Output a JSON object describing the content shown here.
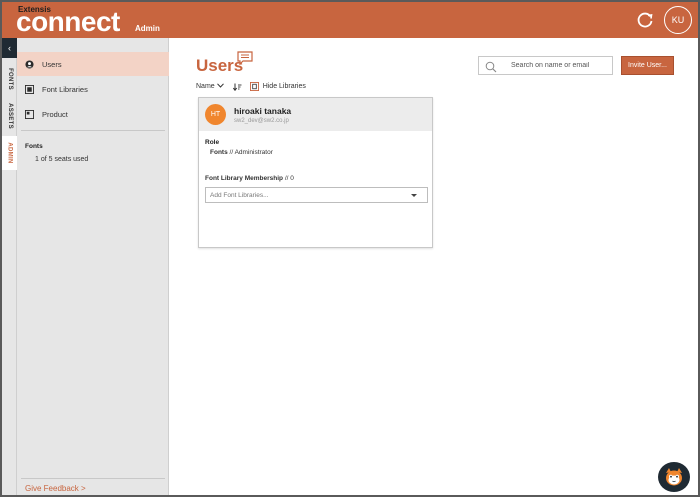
{
  "header": {
    "brand_top": "Extensis",
    "brand_main": "connect",
    "brand_sub": "Admin",
    "user_initials": "KU"
  },
  "rail": {
    "tabs": [
      {
        "label": "FONTS"
      },
      {
        "label": "ASSETS"
      },
      {
        "label": "ADMIN",
        "active": true
      }
    ]
  },
  "sidebar": {
    "items": [
      {
        "label": "Users",
        "icon": "user-circle-icon",
        "active": true
      },
      {
        "label": "Font Libraries",
        "icon": "library-icon"
      },
      {
        "label": "Product",
        "icon": "product-icon"
      }
    ],
    "fonts_heading": "Fonts",
    "seats_text": "1 of 5 seats used",
    "feedback": "Give Feedback >"
  },
  "main": {
    "title": "Users",
    "sort_label": "Name",
    "hide_libraries": "Hide Libraries",
    "search_placeholder": "Search on name or email",
    "invite_button": "Invite User..."
  },
  "card": {
    "initials": "HT",
    "name": "hiroaki tanaka",
    "email": "sw2_dev@sw2.co.jp",
    "role_label": "Role",
    "role_scope": "Fonts",
    "role_sep": "//",
    "role_value": "Administrator",
    "membership_label": "Font Library Membership",
    "membership_count": "// 0",
    "select_placeholder": "Add Font Libraries..."
  },
  "colors": {
    "accent": "#c8653f",
    "avatar": "#f0862e",
    "sidebar": "#e6e6e6",
    "active_nav": "#f3d3c6"
  }
}
